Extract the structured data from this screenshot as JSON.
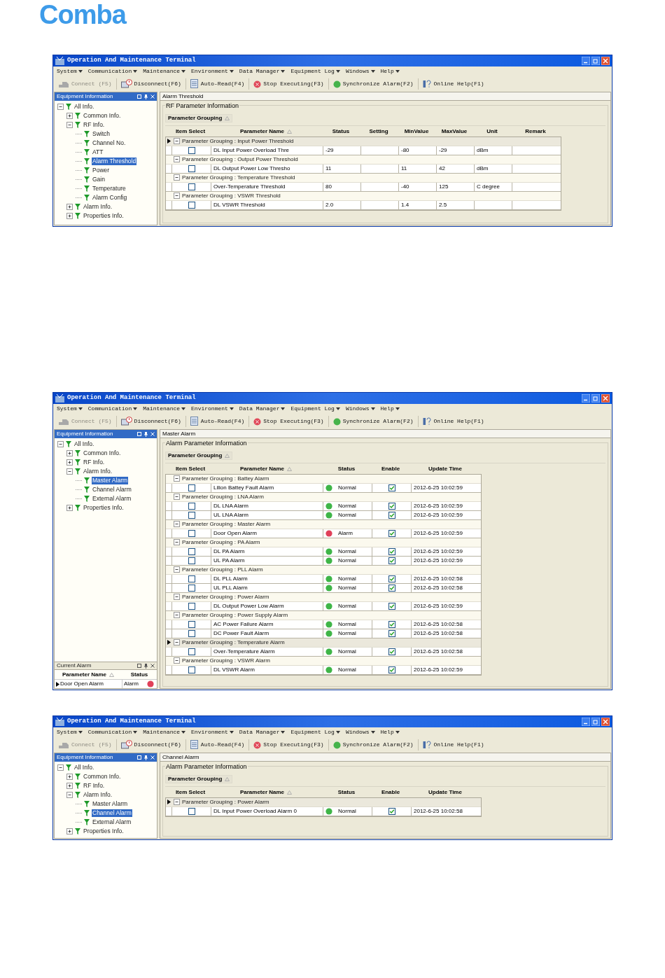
{
  "logo": "Comba",
  "screens": [
    {
      "title": "Operation And Maintenance Terminal",
      "menu": [
        "System",
        "Communication",
        "Maintenance",
        "Environment",
        "Data Manager",
        "Equipment Log",
        "Windows",
        "Help"
      ],
      "toolbar": [
        {
          "label": "Connect (F5)",
          "kind": "plug",
          "disabled": true
        },
        {
          "label": "Disconnect(F6)",
          "kind": "disconnect",
          "disabled": false
        },
        {
          "label": "Auto-Read(F4)",
          "kind": "read",
          "disabled": false
        },
        {
          "label": "Stop Executing(F3)",
          "kind": "stop",
          "disabled": false
        },
        {
          "label": "Synchronize Alarm(F2)",
          "kind": "sync",
          "disabled": false
        },
        {
          "label": "Online Help(F1)",
          "kind": "help",
          "disabled": false
        }
      ],
      "panel_title": "Equipment Information",
      "tree": [
        {
          "label": "All Info.",
          "kind": "branch",
          "expanded": true,
          "selected": false,
          "children": [
            {
              "label": "Common Info.",
              "kind": "branch",
              "expanded": false,
              "selected": false
            },
            {
              "label": "RF Info.",
              "kind": "branch",
              "expanded": true,
              "selected": false,
              "children": [
                {
                  "label": "Switch",
                  "kind": "leaf",
                  "selected": false
                },
                {
                  "label": "Channel No.",
                  "kind": "leaf",
                  "selected": false
                },
                {
                  "label": "ATT",
                  "kind": "leaf",
                  "selected": false
                },
                {
                  "label": "Alarm Threshold",
                  "kind": "leaf",
                  "selected": true
                },
                {
                  "label": "Power",
                  "kind": "leaf",
                  "selected": false
                },
                {
                  "label": "Gain",
                  "kind": "leaf",
                  "selected": false
                },
                {
                  "label": "Temperature",
                  "kind": "leaf",
                  "selected": false
                },
                {
                  "label": "Alarm Config",
                  "kind": "leaf",
                  "selected": false
                }
              ]
            },
            {
              "label": "Alarm Info.",
              "kind": "branch",
              "expanded": false,
              "selected": false
            },
            {
              "label": "Properties Info.",
              "kind": "branch",
              "expanded": false,
              "selected": false
            }
          ]
        }
      ],
      "tab_title": "Alarm Threshold",
      "section_title": "RF Parameter Information",
      "grouping": {
        "label": "Parameter Grouping",
        "sort_mark": true
      },
      "columns": [
        {
          "label": "Item Select",
          "kind": "select",
          "sort_mark": false
        },
        {
          "label": "Parameter Name",
          "kind": "name",
          "sort_mark": true
        },
        {
          "label": "Status",
          "kind": "value",
          "sort_mark": false
        },
        {
          "label": "Setting",
          "kind": "value",
          "sort_mark": false
        },
        {
          "label": "MinValue",
          "kind": "value",
          "sort_mark": false
        },
        {
          "label": "MaxValue",
          "kind": "value",
          "sort_mark": false
        },
        {
          "label": "Unit",
          "kind": "value",
          "sort_mark": false
        },
        {
          "label": "Remark",
          "kind": "remark",
          "sort_mark": false
        }
      ],
      "groups": [
        {
          "label": "Parameter Grouping : Input Power Threshold",
          "current": true,
          "rows": [
            [
              {
                "kind": "check",
                "checked": false
              },
              {
                "kind": "text",
                "text": "DL Input Power Overload Thre"
              },
              {
                "kind": "text",
                "text": "-29"
              },
              {
                "kind": "empty"
              },
              {
                "kind": "text",
                "text": "-80"
              },
              {
                "kind": "text",
                "text": "-29"
              },
              {
                "kind": "text",
                "text": "dBm"
              },
              {
                "kind": "empty"
              }
            ]
          ]
        },
        {
          "label": "Parameter Grouping : Output Power Threshold",
          "current": false,
          "rows": [
            [
              {
                "kind": "check",
                "checked": false
              },
              {
                "kind": "text",
                "text": "DL Output Power Low Thresho"
              },
              {
                "kind": "text",
                "text": "11"
              },
              {
                "kind": "empty"
              },
              {
                "kind": "text",
                "text": "11"
              },
              {
                "kind": "text",
                "text": "42"
              },
              {
                "kind": "text",
                "text": "dBm"
              },
              {
                "kind": "empty"
              }
            ]
          ]
        },
        {
          "label": "Parameter Grouping : Temperature Threshold",
          "current": false,
          "rows": [
            [
              {
                "kind": "check",
                "checked": false
              },
              {
                "kind": "text",
                "text": "Over-Temperature Threshold"
              },
              {
                "kind": "text",
                "text": "80"
              },
              {
                "kind": "empty"
              },
              {
                "kind": "text",
                "text": "-40"
              },
              {
                "kind": "text",
                "text": "125"
              },
              {
                "kind": "text",
                "text": "C degree"
              },
              {
                "kind": "empty"
              }
            ]
          ]
        },
        {
          "label": "Parameter Grouping : VSWR Threshold",
          "current": false,
          "rows": [
            [
              {
                "kind": "check",
                "checked": false
              },
              {
                "kind": "text",
                "text": "DL VSWR Threshold"
              },
              {
                "kind": "text",
                "text": "2.0"
              },
              {
                "kind": "empty"
              },
              {
                "kind": "text",
                "text": "1.4"
              },
              {
                "kind": "text",
                "text": "2.5"
              },
              {
                "kind": "empty"
              },
              {
                "kind": "empty"
              }
            ]
          ]
        }
      ]
    },
    {
      "title": "Operation And Maintenance Terminal",
      "menu": [
        "System",
        "Communication",
        "Maintenance",
        "Environment",
        "Data Manager",
        "Equipment Log",
        "Windows",
        "Help"
      ],
      "toolbar": [
        {
          "label": "Connect (F5)",
          "kind": "plug",
          "disabled": true
        },
        {
          "label": "Disconnect(F6)",
          "kind": "disconnect",
          "disabled": false
        },
        {
          "label": "Auto-Read(F4)",
          "kind": "read",
          "disabled": false
        },
        {
          "label": "Stop Executing(F3)",
          "kind": "stop",
          "disabled": false
        },
        {
          "label": "Synchronize Alarm(F2)",
          "kind": "sync",
          "disabled": false
        },
        {
          "label": "Online Help(F1)",
          "kind": "help",
          "disabled": false
        }
      ],
      "panel_title": "Equipment Information",
      "tree": [
        {
          "label": "All Info.",
          "kind": "branch",
          "expanded": true,
          "selected": false,
          "children": [
            {
              "label": "Common Info.",
              "kind": "branch",
              "expanded": false,
              "selected": false
            },
            {
              "label": "RF Info.",
              "kind": "branch",
              "expanded": false,
              "selected": false
            },
            {
              "label": "Alarm Info.",
              "kind": "branch",
              "expanded": true,
              "selected": false,
              "children": [
                {
                  "label": "Master Alarm",
                  "kind": "leaf",
                  "selected": true
                },
                {
                  "label": "Channel Alarm",
                  "kind": "leaf",
                  "selected": false
                },
                {
                  "label": "External Alarm",
                  "kind": "leaf",
                  "selected": false
                }
              ]
            },
            {
              "label": "Properties Info.",
              "kind": "branch",
              "expanded": false,
              "selected": false
            }
          ]
        }
      ],
      "current_alarm": {
        "title": "Current Alarm",
        "columns": [
          {
            "label": "Parameter Name",
            "sort_mark": true
          },
          {
            "label": "Status",
            "sort_mark": false
          }
        ],
        "rows": [
          {
            "current": true,
            "name": "Door Open Alarm",
            "status": "Alarm",
            "color": "#e0405a"
          }
        ]
      },
      "tab_title": "Master Alarm",
      "section_title": "Alarm Parameter Information",
      "grouping": {
        "label": "Parameter Grouping",
        "sort_mark": true
      },
      "columns": [
        {
          "label": "Item Select",
          "kind": "select",
          "sort_mark": false
        },
        {
          "label": "Parameter Name",
          "kind": "name",
          "sort_mark": true
        },
        {
          "label": "Status",
          "kind": "status",
          "sort_mark": false
        },
        {
          "label": "Enable",
          "kind": "check",
          "sort_mark": false
        },
        {
          "label": "Update Time",
          "kind": "time",
          "sort_mark": false
        }
      ],
      "groups": [
        {
          "label": "Parameter Grouping : Battey Alarm",
          "current": false,
          "rows": [
            [
              {
                "kind": "check",
                "checked": false
              },
              {
                "kind": "text",
                "text": "Lilion Battey Fault Alarm"
              },
              {
                "kind": "status",
                "text": "Normal",
                "color": "#3fb548"
              },
              {
                "kind": "check",
                "checked": true
              },
              {
                "kind": "text",
                "text": "2012-6-25 10:02:59"
              }
            ]
          ]
        },
        {
          "label": "Parameter Grouping : LNA Alarm",
          "current": false,
          "rows": [
            [
              {
                "kind": "check",
                "checked": false
              },
              {
                "kind": "text",
                "text": "DL LNA Alarm"
              },
              {
                "kind": "status",
                "text": "Normal",
                "color": "#3fb548"
              },
              {
                "kind": "check",
                "checked": true
              },
              {
                "kind": "text",
                "text": "2012-6-25 10:02:59"
              }
            ],
            [
              {
                "kind": "check",
                "checked": false
              },
              {
                "kind": "text",
                "text": "UL LNA Alarm"
              },
              {
                "kind": "status",
                "text": "Normal",
                "color": "#3fb548"
              },
              {
                "kind": "check",
                "checked": true
              },
              {
                "kind": "text",
                "text": "2012-6-25 10:02:59"
              }
            ]
          ]
        },
        {
          "label": "Parameter Grouping : Master Alarm",
          "current": false,
          "rows": [
            [
              {
                "kind": "check",
                "checked": false
              },
              {
                "kind": "text",
                "text": "Door Open Alarm"
              },
              {
                "kind": "status",
                "text": "Alarm",
                "color": "#e0405a"
              },
              {
                "kind": "check",
                "checked": true
              },
              {
                "kind": "text",
                "text": "2012-6-25 10:02:59"
              }
            ]
          ]
        },
        {
          "label": "Parameter Grouping : PA Alarm",
          "current": false,
          "rows": [
            [
              {
                "kind": "check",
                "checked": false
              },
              {
                "kind": "text",
                "text": "DL PA Alarm"
              },
              {
                "kind": "status",
                "text": "Normal",
                "color": "#3fb548"
              },
              {
                "kind": "check",
                "checked": true
              },
              {
                "kind": "text",
                "text": "2012-6-25 10:02:59"
              }
            ],
            [
              {
                "kind": "check",
                "checked": false
              },
              {
                "kind": "text",
                "text": "UL PA Alarm"
              },
              {
                "kind": "status",
                "text": "Normal",
                "color": "#3fb548"
              },
              {
                "kind": "check",
                "checked": true
              },
              {
                "kind": "text",
                "text": "2012-6-25 10:02:59"
              }
            ]
          ]
        },
        {
          "label": "Parameter Grouping : PLL Alarm",
          "current": false,
          "rows": [
            [
              {
                "kind": "check",
                "checked": false
              },
              {
                "kind": "text",
                "text": "DL PLL Alarm"
              },
              {
                "kind": "status",
                "text": "Normal",
                "color": "#3fb548"
              },
              {
                "kind": "check",
                "checked": true
              },
              {
                "kind": "text",
                "text": "2012-6-25 10:02:58"
              }
            ],
            [
              {
                "kind": "check",
                "checked": false
              },
              {
                "kind": "text",
                "text": "UL PLL Alarm"
              },
              {
                "kind": "status",
                "text": "Normal",
                "color": "#3fb548"
              },
              {
                "kind": "check",
                "checked": true
              },
              {
                "kind": "text",
                "text": "2012-6-25 10:02:58"
              }
            ]
          ]
        },
        {
          "label": "Parameter Grouping : Power Alarm",
          "current": false,
          "rows": [
            [
              {
                "kind": "check",
                "checked": false
              },
              {
                "kind": "text",
                "text": "DL Output Power Low Alarm"
              },
              {
                "kind": "status",
                "text": "Normal",
                "color": "#3fb548"
              },
              {
                "kind": "check",
                "checked": true
              },
              {
                "kind": "text",
                "text": "2012-6-25 10:02:59"
              }
            ]
          ]
        },
        {
          "label": "Parameter Grouping : Power Supply Alarm",
          "current": false,
          "rows": [
            [
              {
                "kind": "check",
                "checked": false
              },
              {
                "kind": "text",
                "text": "AC Power Failure Alarm"
              },
              {
                "kind": "status",
                "text": "Normal",
                "color": "#3fb548"
              },
              {
                "kind": "check",
                "checked": true
              },
              {
                "kind": "text",
                "text": "2012-6-25 10:02:58"
              }
            ],
            [
              {
                "kind": "check",
                "checked": false
              },
              {
                "kind": "text",
                "text": "DC Power Fault Alarm"
              },
              {
                "kind": "status",
                "text": "Normal",
                "color": "#3fb548"
              },
              {
                "kind": "check",
                "checked": true
              },
              {
                "kind": "text",
                "text": "2012-6-25 10:02:58"
              }
            ]
          ]
        },
        {
          "label": "Parameter Grouping : Temperature Alarm",
          "current": true,
          "rows": [
            [
              {
                "kind": "check",
                "checked": false
              },
              {
                "kind": "text",
                "text": "Over-Temperature Alarm"
              },
              {
                "kind": "status",
                "text": "Normal",
                "color": "#3fb548"
              },
              {
                "kind": "check",
                "checked": true
              },
              {
                "kind": "text",
                "text": "2012-6-25 10:02:58"
              }
            ]
          ]
        },
        {
          "label": "Parameter Grouping : VSWR Alarm",
          "current": false,
          "rows": [
            [
              {
                "kind": "check",
                "checked": false
              },
              {
                "kind": "text",
                "text": "DL VSWR Alarm"
              },
              {
                "kind": "status",
                "text": "Normal",
                "color": "#3fb548"
              },
              {
                "kind": "check",
                "checked": true
              },
              {
                "kind": "text",
                "text": "2012-6-25 10:02:59"
              }
            ]
          ]
        }
      ]
    },
    {
      "title": "Operation And Maintenance Terminal",
      "menu": [
        "System",
        "Communication",
        "Maintenance",
        "Environment",
        "Data Manager",
        "Equipment Log",
        "Windows",
        "Help"
      ],
      "toolbar": [
        {
          "label": "Connect (F5)",
          "kind": "plug",
          "disabled": true
        },
        {
          "label": "Disconnect(F6)",
          "kind": "disconnect",
          "disabled": false
        },
        {
          "label": "Auto-Read(F4)",
          "kind": "read",
          "disabled": false
        },
        {
          "label": "Stop Executing(F3)",
          "kind": "stop",
          "disabled": false
        },
        {
          "label": "Synchronize Alarm(F2)",
          "kind": "sync",
          "disabled": false
        },
        {
          "label": "Online Help(F1)",
          "kind": "help",
          "disabled": false
        }
      ],
      "panel_title": "Equipment Information",
      "tree": [
        {
          "label": "All Info.",
          "kind": "branch",
          "expanded": true,
          "selected": false,
          "children": [
            {
              "label": "Common Info.",
              "kind": "branch",
              "expanded": false,
              "selected": false
            },
            {
              "label": "RF Info.",
              "kind": "branch",
              "expanded": false,
              "selected": false
            },
            {
              "label": "Alarm Info.",
              "kind": "branch",
              "expanded": true,
              "selected": false,
              "children": [
                {
                  "label": "Master Alarm",
                  "kind": "leaf",
                  "selected": false
                },
                {
                  "label": "Channel Alarm",
                  "kind": "leaf",
                  "selected": true
                },
                {
                  "label": "External Alarm",
                  "kind": "leaf",
                  "selected": false
                }
              ]
            },
            {
              "label": "Properties Info.",
              "kind": "branch",
              "expanded": false,
              "selected": false
            }
          ]
        }
      ],
      "tab_title": "Channel Alarm",
      "section_title": "Alarm Parameter Information",
      "grouping": {
        "label": "Parameter Grouping",
        "sort_mark": true
      },
      "columns": [
        {
          "label": "Item Select",
          "kind": "select",
          "sort_mark": false
        },
        {
          "label": "Parameter Name",
          "kind": "name",
          "sort_mark": true
        },
        {
          "label": "Status",
          "kind": "status",
          "sort_mark": false
        },
        {
          "label": "Enable",
          "kind": "check",
          "sort_mark": false
        },
        {
          "label": "Update Time",
          "kind": "time",
          "sort_mark": false
        }
      ],
      "groups": [
        {
          "label": "Parameter Grouping : Power Alarm",
          "current": true,
          "rows": [
            [
              {
                "kind": "check",
                "checked": false
              },
              {
                "kind": "text",
                "text": "DL Input Power Overload Alarm 0"
              },
              {
                "kind": "status",
                "text": "Normal",
                "color": "#3fb548"
              },
              {
                "kind": "check",
                "checked": true
              },
              {
                "kind": "text",
                "text": "2012-6-25 10:02:58"
              }
            ]
          ]
        }
      ]
    }
  ]
}
